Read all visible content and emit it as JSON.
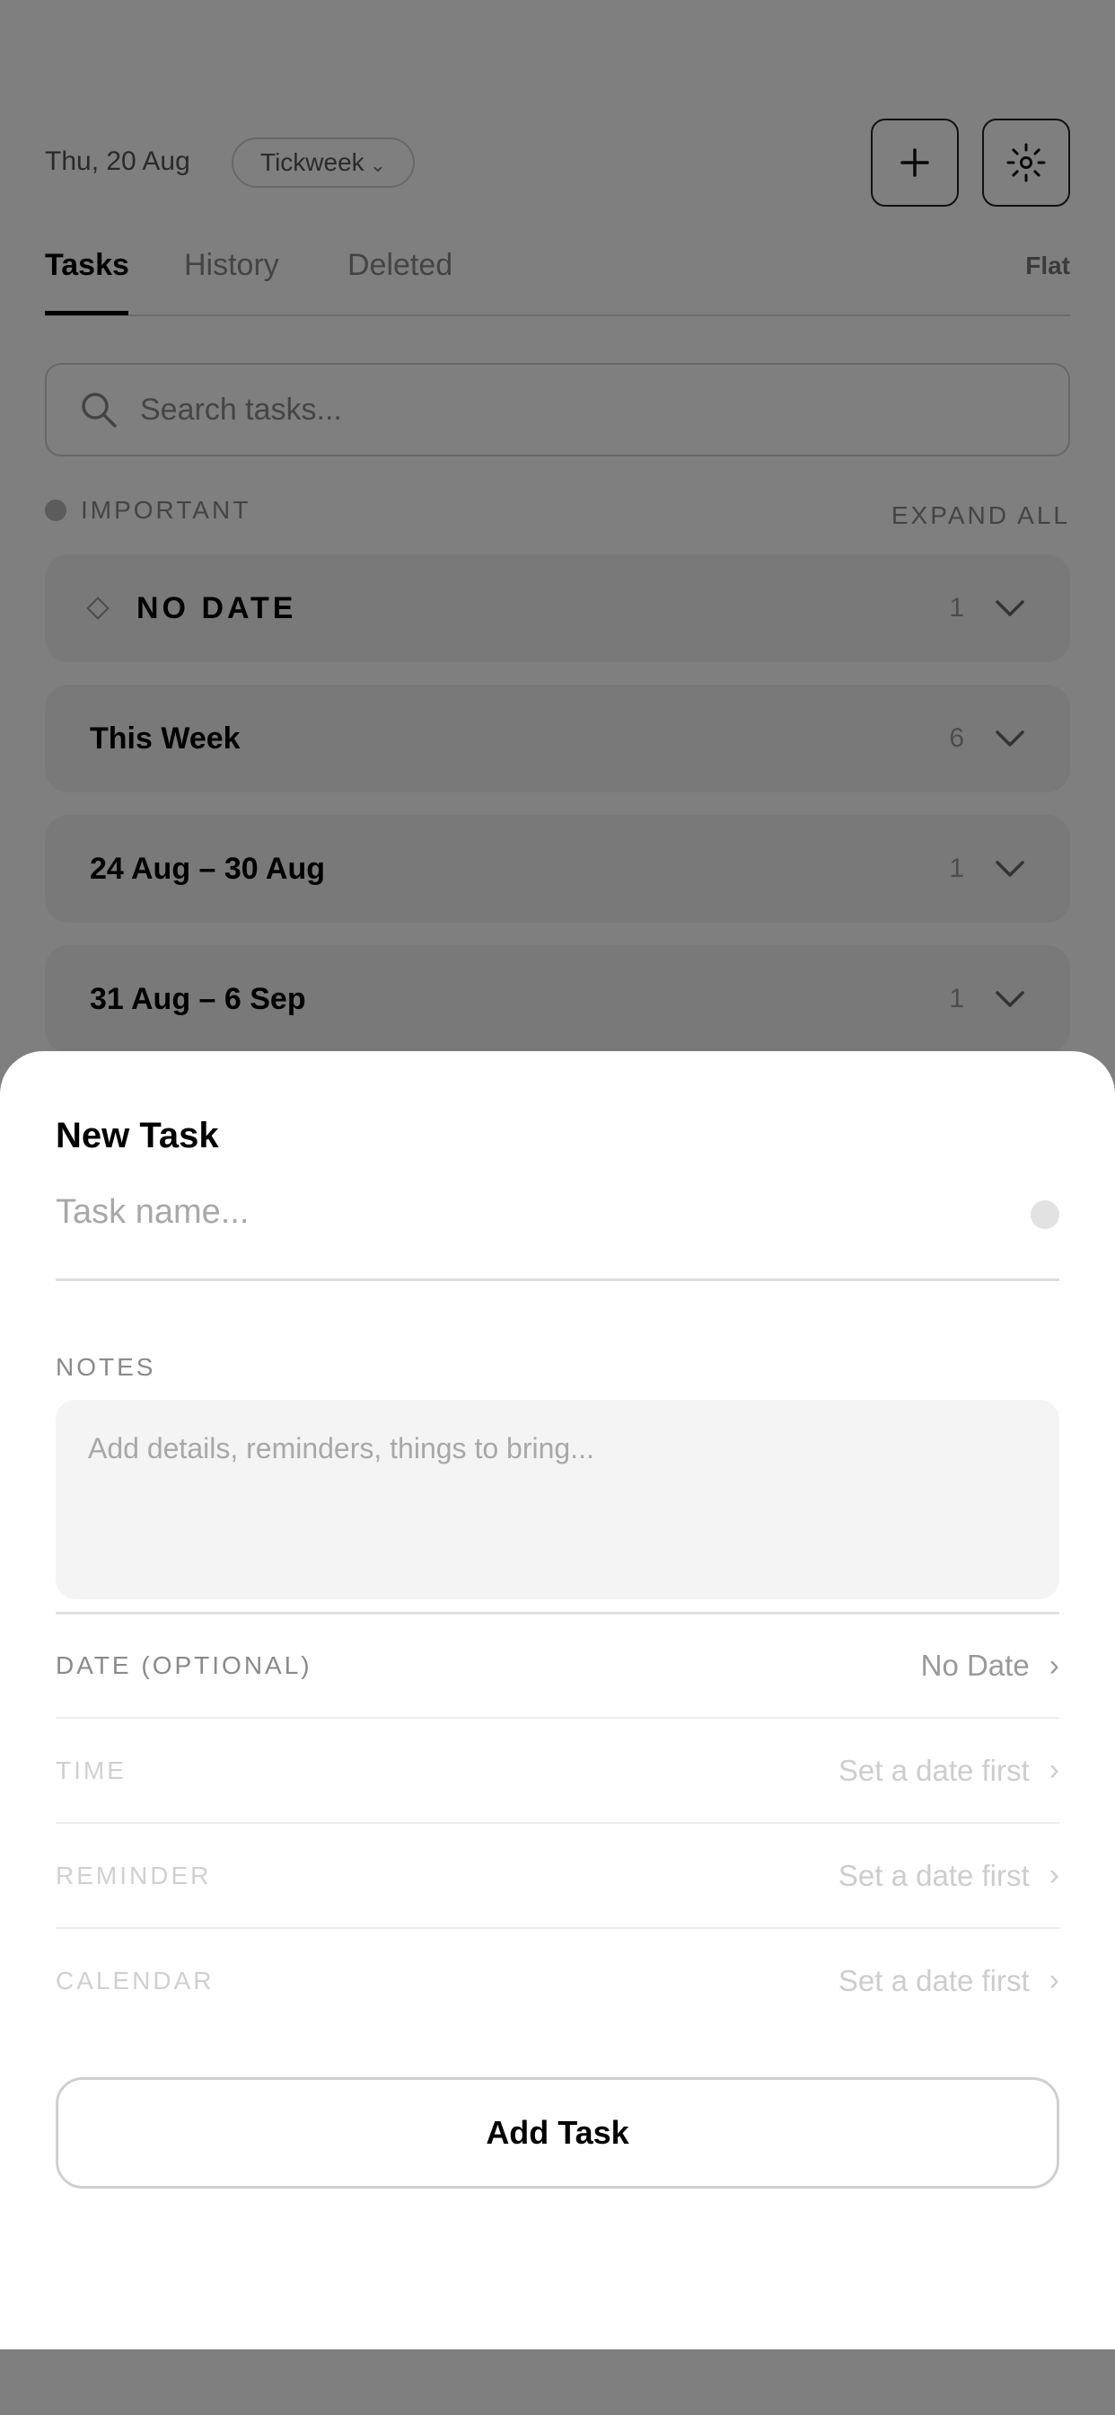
{
  "header": {
    "date": "Thu, 20 Aug",
    "workspace": "Tickweek",
    "workspace_chevron": "⌄",
    "add_icon": "plus-icon",
    "settings_icon": "sun-icon"
  },
  "tabs": [
    {
      "label": "Tasks",
      "active": true
    },
    {
      "label": "History",
      "active": false
    },
    {
      "label": "Deleted",
      "active": false
    }
  ],
  "view_mode": "Flat",
  "search": {
    "placeholder": "Search tasks..."
  },
  "filters": {
    "important_label": "IMPORTANT",
    "expand_all": "EXPAND ALL"
  },
  "groups": [
    {
      "name": "NO DATE",
      "count": "1"
    },
    {
      "name": "This Week",
      "count": "6"
    },
    {
      "name": "24 Aug – 30 Aug",
      "count": "1"
    },
    {
      "name": "31 Aug – 6 Sep",
      "count": "1"
    }
  ],
  "sheet": {
    "title": "New Task",
    "task_name_placeholder": "Task name...",
    "notes_label": "NOTES",
    "notes_placeholder": "Add details, reminders, things to bring...",
    "rows": [
      {
        "label": "DATE (OPTIONAL)",
        "value": "No Date",
        "enabled": true
      },
      {
        "label": "TIME",
        "value": "Set a date first",
        "enabled": false
      },
      {
        "label": "REMINDER",
        "value": "Set a date first",
        "enabled": false
      },
      {
        "label": "CALENDAR",
        "value": "Set a date first",
        "enabled": false
      }
    ],
    "chevron": "›",
    "submit_label": "Add Task"
  },
  "colors": {
    "overlay": "#000000",
    "sheet_bg": "#ffffff",
    "notes_bg": "#f4f4f4"
  }
}
